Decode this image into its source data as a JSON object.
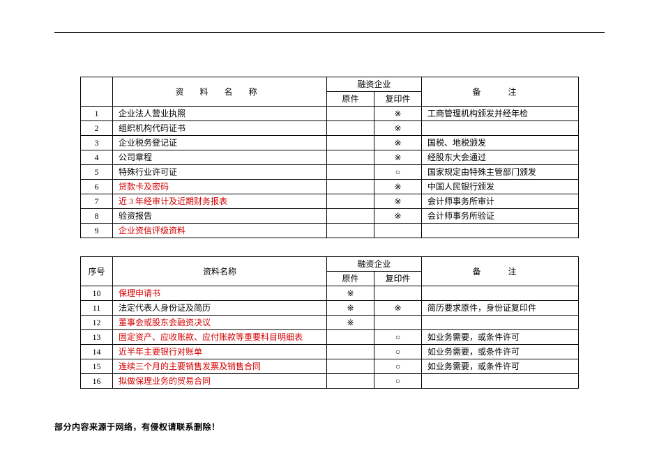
{
  "marks": {
    "star": "※",
    "circle": "○"
  },
  "table1": {
    "head": {
      "name": "资 料 名 称",
      "group": "融资企业",
      "yuan": "原件",
      "fyj": "复印件",
      "remark": "备 注"
    },
    "rows": [
      {
        "idx": "1",
        "name": "企业法人营业执照",
        "red": false,
        "yuan": "",
        "fyj": "※",
        "remark": "工商管理机构颁发并经年检"
      },
      {
        "idx": "2",
        "name": "组织机构代码证书",
        "red": false,
        "yuan": "",
        "fyj": "※",
        "remark": ""
      },
      {
        "idx": "3",
        "name": "企业税务登记证",
        "red": false,
        "yuan": "",
        "fyj": "※",
        "remark": "国税、地税颁发"
      },
      {
        "idx": "4",
        "name": "公司章程",
        "red": false,
        "yuan": "",
        "fyj": "※",
        "remark": "经股东大会通过"
      },
      {
        "idx": "5",
        "name": "特殊行业许可证",
        "red": false,
        "yuan": "",
        "fyj": "○",
        "remark": "国家规定由特殊主管部门颁发"
      },
      {
        "idx": "6",
        "name": "贷款卡及密码",
        "red": true,
        "yuan": "",
        "fyj": "※",
        "remark": "中国人民银行颁发"
      },
      {
        "idx": "7",
        "name": "近 3 年经审计及近期财务报表",
        "red": true,
        "yuan": "",
        "fyj": "※",
        "remark": "会计师事务所审计"
      },
      {
        "idx": "8",
        "name": "验资报告",
        "red": false,
        "yuan": "",
        "fyj": "※",
        "remark": "会计师事务所验证"
      },
      {
        "idx": "9",
        "name": "企业资信评级资料",
        "red": true,
        "yuan": "",
        "fyj": "",
        "remark": ""
      }
    ]
  },
  "table2": {
    "head": {
      "seq": "序号",
      "name": "资料名称",
      "group": "融资企业",
      "yuan": "原件",
      "fyj": "复印件",
      "remark": "备  注"
    },
    "rows": [
      {
        "idx": "10",
        "name": "保理申请书",
        "red": true,
        "yuan": "※",
        "fyj": "",
        "remark": ""
      },
      {
        "idx": "11",
        "name": "法定代表人身份证及简历",
        "red": false,
        "yuan": "※",
        "fyj": "※",
        "remark": "简历要求原件，身份证复印件"
      },
      {
        "idx": "12",
        "name": "董事会或股东会融资决议",
        "red": true,
        "yuan": "※",
        "fyj": "",
        "remark": ""
      },
      {
        "idx": "13",
        "name": "固定资产、应收账款、应付账款等重要科目明细表",
        "red": true,
        "yuan": "",
        "fyj": "○",
        "remark": "如业务需要，或条件许可"
      },
      {
        "idx": "14",
        "name": "近半年主要银行对账单",
        "red": true,
        "yuan": "",
        "fyj": "○",
        "remark": "如业务需要，或条件许可"
      },
      {
        "idx": "15",
        "name": "连续三个月的主要销售发票及销售合同",
        "red": true,
        "yuan": "",
        "fyj": "○",
        "remark": "如业务需要，或条件许可"
      },
      {
        "idx": "16",
        "name": "拟做保理业务的贸易合同",
        "red": true,
        "yuan": "",
        "fyj": "○",
        "remark": ""
      }
    ]
  },
  "footer": "部分内容来源于网络，有侵权请联系删除！"
}
